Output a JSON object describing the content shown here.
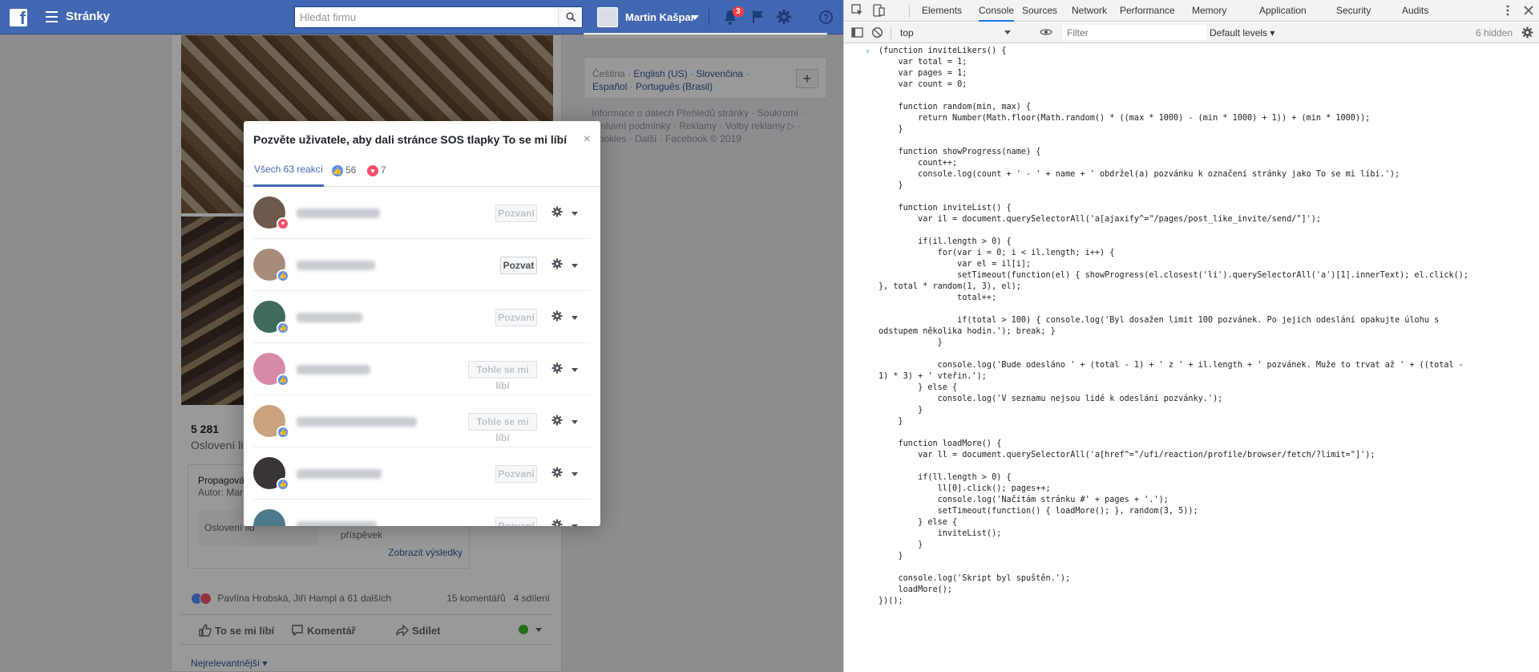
{
  "fb": {
    "topbar": {
      "pages_label": "Stránky",
      "search_placeholder": "Hledat firmu",
      "user_name": "Martin Kašpar",
      "notif_count": "3"
    },
    "post": {
      "reach_count": "5 281",
      "reach_label": "Oslovení lid",
      "boost_title": "Propagová",
      "boost_author": "Autor: Mar",
      "boost_reach_label": "Oslovení lid",
      "boost_right": "příspěvek",
      "boost_link": "Zobrazit výsledky",
      "reaction_names": "Pavlína Hrobská, Jiří Hampl a 61 dalších",
      "reaction_counts": "15 komentářů   4 sdílení",
      "action_like": "To se mi líbí",
      "action_comment": "Komentář",
      "action_share": "Sdílet",
      "sort": "Nejrelevantnější"
    },
    "sidebar": {
      "lang_current": "Čeština",
      "lang_others": [
        "English (US)",
        "Slovenčina",
        "Español",
        "Português (Brasil)"
      ],
      "footer": "Informace o datech Přehledů stránky · Soukromí · Smluvní podmínky · Reklamy · Volby reklamy ▷ · Cookies · Další · Facebook © 2019"
    },
    "modal": {
      "title": "Pozvěte uživatele, aby dali stránce SOS tlapky To se mi líbí",
      "close": "×",
      "tab_all": "Všech 63 reakcí",
      "tab_like_count": "56",
      "tab_love_count": "7",
      "rows": [
        {
          "reaction": "love",
          "button": "Pozvaní",
          "state": "done",
          "av": "#6d5a4c"
        },
        {
          "reaction": "like",
          "button": "Pozvat",
          "state": "active",
          "av": "#a88c7a"
        },
        {
          "reaction": "like",
          "button": "Pozvaní",
          "state": "done",
          "av": "#3f6b5a"
        },
        {
          "reaction": "like",
          "button": "Tohle se mi líbí",
          "state": "done",
          "av": "#d889a8"
        },
        {
          "reaction": "like",
          "button": "Tohle se mi líbí",
          "state": "done",
          "av": "#c9a27e"
        },
        {
          "reaction": "like",
          "button": "Pozvaní",
          "state": "done",
          "av": "#3a3434"
        },
        {
          "reaction": "like",
          "button": "Pozvaní",
          "state": "done",
          "av": "#4d7a8a"
        }
      ]
    }
  },
  "devtools": {
    "tabs": [
      "Elements",
      "Console",
      "Sources",
      "Network",
      "Performance",
      "Memory",
      "Application",
      "Security",
      "Audits"
    ],
    "active_tab": "Console",
    "context": "top",
    "filter_placeholder": "Filter",
    "levels": "Default levels ▾",
    "hidden": "6 hidden",
    "prompt": "›",
    "code_lines": [
      "(function inviteLikers() {",
      "    var total = 1;",
      "    var pages = 1;",
      "    var count = 0;",
      "",
      "    function random(min, max) {",
      "        return Number(Math.floor(Math.random() * ((max * 1000) - (min * 1000) + 1)) + (min * 1000));",
      "    }",
      "",
      "    function showProgress(name) {",
      "        count++;",
      "        console.log(count + ' - ' + name + ' obdržel(a) pozvánku k označení stránky jako To se mi líbí.');",
      "    }",
      "",
      "    function inviteList() {",
      "        var il = document.querySelectorAll('a[ajaxify^=\"/pages/post_like_invite/send/\"]');",
      "",
      "        if(il.length > 0) {",
      "            for(var i = 0; i < il.length; i++) {",
      "                var el = il[i];",
      "                setTimeout(function(el) { showProgress(el.closest('li').querySelectorAll('a')[1].innerText); el.click();",
      "}, total * random(1, 3), el);",
      "                total++;",
      "",
      "                if(total > 100) { console.log('Byl dosažen limit 100 pozvánek. Po jejich odeslání opakujte úlohu s",
      "odstupem několika hodin.'); break; }",
      "            }",
      "",
      "            console.log('Bude odesláno ' + (total - 1) + ' z ' + il.length + ' pozvánek. Muže to trvat až ' + ((total -",
      "1) * 3) + ' vteřin.');",
      "        } else {",
      "            console.log('V seznamu nejsou lidé k odeslání pozvánky.');",
      "        }",
      "    }",
      "",
      "    function loadMore() {",
      "        var ll = document.querySelectorAll('a[href^=\"/ufi/reaction/profile/browser/fetch/?limit=\"]');",
      "",
      "        if(ll.length > 0) {",
      "            ll[0].click(); pages++;",
      "            console.log('Načítám stránku #' + pages + '.');",
      "            setTimeout(function() { loadMore(); }, random(3, 5));",
      "        } else {",
      "            inviteList();",
      "        }",
      "    }",
      "",
      "    console.log('Skript byl spuštěn.');",
      "    loadMore();",
      "})();"
    ]
  }
}
